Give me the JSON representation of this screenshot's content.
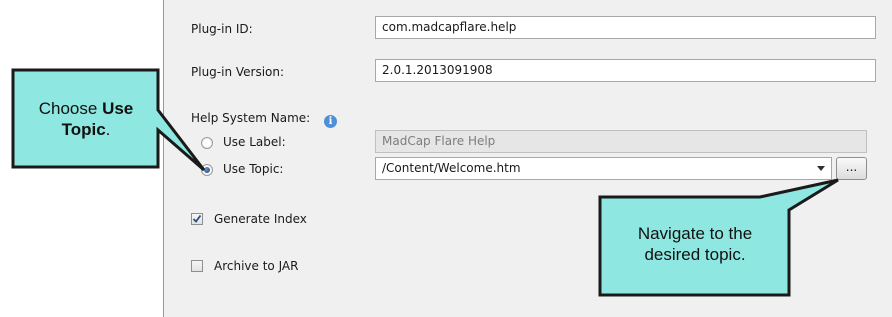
{
  "form": {
    "plugin_id_label": "Plug-in ID:",
    "plugin_id_value": "com.madcapflare.help",
    "plugin_version_label": "Plug-in Version:",
    "plugin_version_value": "2.0.1.2013091908",
    "help_system_name_label": "Help System Name:",
    "use_label_option": "Use Label:",
    "use_label_value": "MadCap Flare Help",
    "use_topic_option": "Use Topic:",
    "use_topic_value": "/Content/Welcome.htm",
    "browse_button": "...",
    "generate_index_label": "Generate Index",
    "generate_index_checked": true,
    "archive_to_jar_label": "Archive to JAR",
    "archive_to_jar_checked": false,
    "selected_option": "Use Topic"
  },
  "callouts": {
    "left_prefix": "Choose ",
    "left_bold": "Use Topic",
    "left_suffix": ".",
    "right_line1": "Navigate to the",
    "right_line2": "desired topic."
  },
  "colors": {
    "callout_fill": "#8ee8e1",
    "callout_border": "#1a1a1a",
    "panel_background": "#f0f0f0"
  }
}
